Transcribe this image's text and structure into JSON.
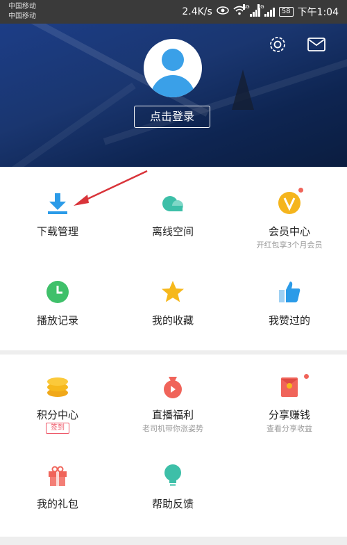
{
  "status_bar": {
    "carrier_1": "中国移动",
    "carrier_2": "中国移动",
    "speed": "2.4K/s",
    "signal_1_tag": "4G",
    "signal_2_tag": "2G",
    "battery": "58",
    "time": "下午1:04"
  },
  "header": {
    "login_label": "点击登录"
  },
  "section_1": {
    "items": [
      {
        "label": "下载管理",
        "icon": "download-icon"
      },
      {
        "label": "离线空间",
        "icon": "cloud-icon"
      },
      {
        "label": "会员中心",
        "sub": "开红包享3个月会员",
        "icon": "vip-icon"
      },
      {
        "label": "播放记录",
        "icon": "clock-icon"
      },
      {
        "label": "我的收藏",
        "icon": "star-icon"
      },
      {
        "label": "我赞过的",
        "icon": "thumbs-up-icon"
      }
    ]
  },
  "section_2": {
    "items": [
      {
        "label": "积分中心",
        "badge": "签到",
        "icon": "coins-icon"
      },
      {
        "label": "直播福利",
        "sub": "老司机带你涨姿势",
        "icon": "money-bag-icon"
      },
      {
        "label": "分享赚钱",
        "sub": "查看分享收益",
        "icon": "red-envelope-icon"
      },
      {
        "label": "我的礼包",
        "icon": "gift-icon"
      },
      {
        "label": "帮助反馈",
        "icon": "lightbulb-icon"
      }
    ]
  },
  "colors": {
    "accent_blue": "#2b9be8",
    "teal": "#3dbfa8",
    "vip_gold": "#f5b51d",
    "green": "#3fc06a",
    "star": "#f6b81c",
    "red": "#f0645a",
    "header_bg": "#1a3670"
  }
}
